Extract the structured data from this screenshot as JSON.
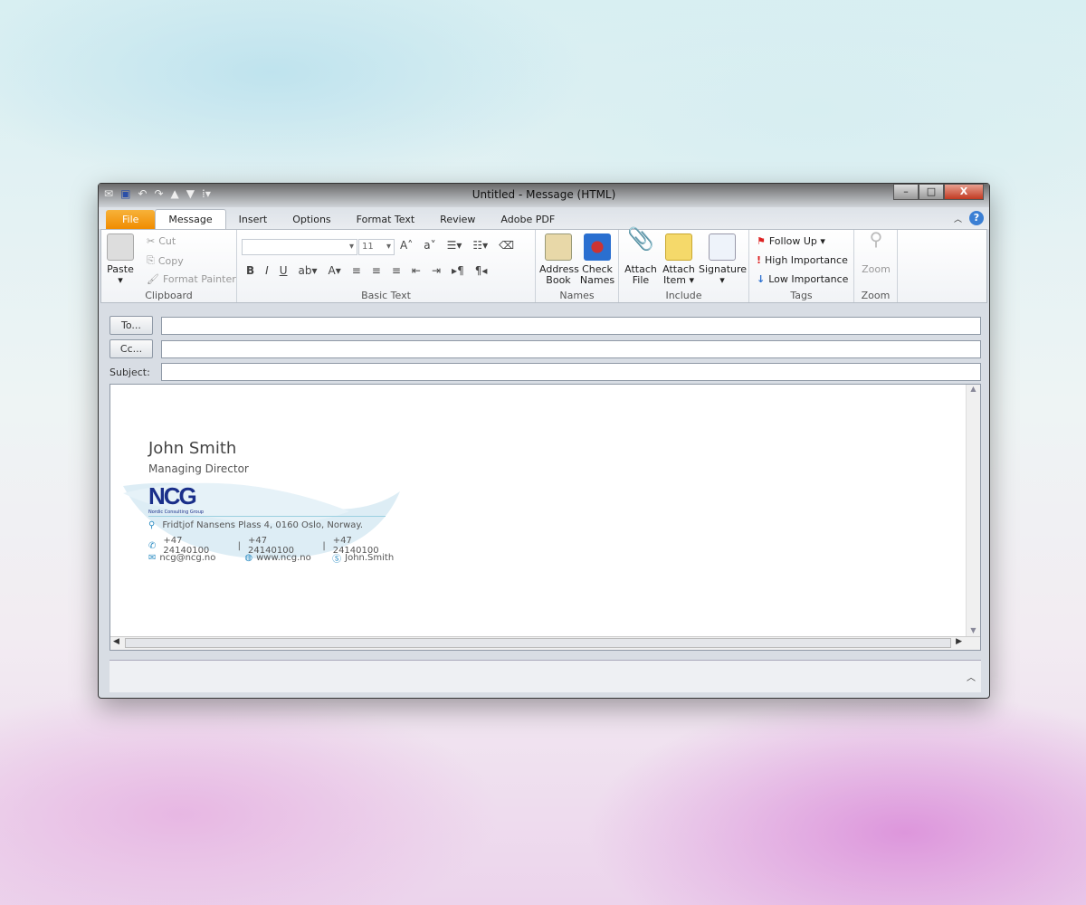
{
  "window": {
    "title": "Untitled  -  Message (HTML)"
  },
  "tabs": [
    "File",
    "Message",
    "Insert",
    "Options",
    "Format Text",
    "Review",
    "Adobe PDF"
  ],
  "clipboard": {
    "paste": "Paste",
    "cut": "Cut",
    "copy": "Copy",
    "format_painter": "Format Painter",
    "label": "Clipboard"
  },
  "basic_text": {
    "font": "",
    "size": "11",
    "label": "Basic Text"
  },
  "names": {
    "address_book": [
      "Address",
      "Book"
    ],
    "check_names": [
      "Check",
      "Names"
    ],
    "label": "Names"
  },
  "include": {
    "attach_file": [
      "Attach",
      "File"
    ],
    "attach_item": [
      "Attach",
      "Item ▾"
    ],
    "signature": "Signature",
    "label": "Include"
  },
  "tags": {
    "follow_up": "Follow Up ▾",
    "high": "High Importance",
    "low": "Low Importance",
    "label": "Tags"
  },
  "zoom": {
    "button": "Zoom",
    "label": "Zoom"
  },
  "address": {
    "to": "To...",
    "cc": "Cc...",
    "subject": "Subject:",
    "to_value": "",
    "cc_value": "",
    "subject_value": ""
  },
  "signature": {
    "name": "John Smith",
    "role": "Managing Director",
    "logo": "NCG",
    "logo_sub": "Nordic Consulting Group",
    "address": "Fridtjof Nansens Plass 4, 0160 Oslo, Norway.",
    "phones": [
      "+47 24140100",
      "+47 24140100",
      "+47 24140100"
    ],
    "email": "ncg@ncg.no",
    "web": "www.ncg.no",
    "skype": "John.Smith"
  }
}
